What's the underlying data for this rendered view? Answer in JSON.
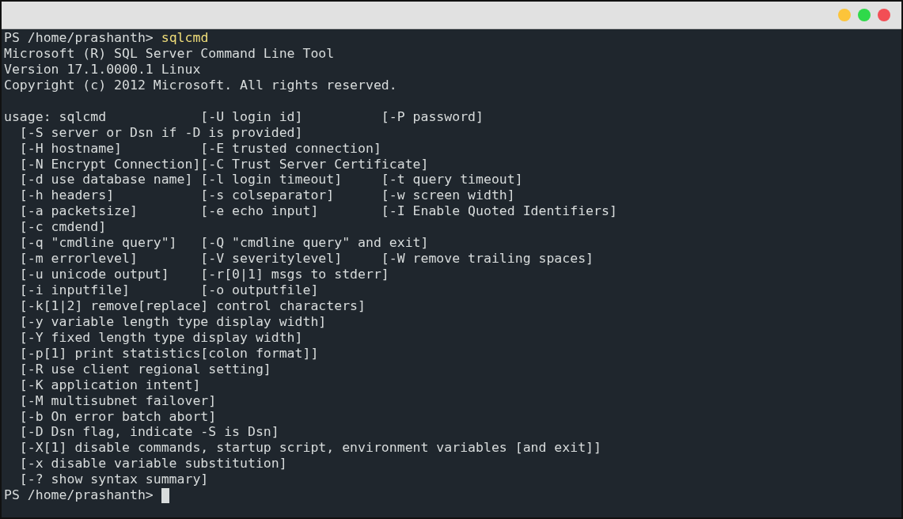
{
  "window": {
    "controls": [
      {
        "color": "#fcc43a"
      },
      {
        "color": "#2fd94a"
      },
      {
        "color": "#f24e55"
      }
    ]
  },
  "lines": [
    {
      "kind": "command",
      "prompt": "PS /home/prashanth>",
      "command": "sqlcmd"
    },
    {
      "kind": "output",
      "text": "Microsoft (R) SQL Server Command Line Tool"
    },
    {
      "kind": "output",
      "text": "Version 17.1.0000.1 Linux"
    },
    {
      "kind": "output",
      "text": "Copyright (c) 2012 Microsoft. All rights reserved."
    },
    {
      "kind": "blank"
    },
    {
      "kind": "output",
      "text": "usage: sqlcmd            [-U login id]          [-P password]"
    },
    {
      "kind": "output",
      "text": "  [-S server or Dsn if -D is provided]"
    },
    {
      "kind": "output",
      "text": "  [-H hostname]          [-E trusted connection]"
    },
    {
      "kind": "output",
      "text": "  [-N Encrypt Connection][-C Trust Server Certificate]"
    },
    {
      "kind": "output",
      "text": "  [-d use database name] [-l login timeout]     [-t query timeout]"
    },
    {
      "kind": "output",
      "text": "  [-h headers]           [-s colseparator]      [-w screen width]"
    },
    {
      "kind": "output",
      "text": "  [-a packetsize]        [-e echo input]        [-I Enable Quoted Identifiers]"
    },
    {
      "kind": "output",
      "text": "  [-c cmdend]"
    },
    {
      "kind": "output",
      "text": "  [-q \"cmdline query\"]   [-Q \"cmdline query\" and exit]"
    },
    {
      "kind": "output",
      "text": "  [-m errorlevel]        [-V severitylevel]     [-W remove trailing spaces]"
    },
    {
      "kind": "output",
      "text": "  [-u unicode output]    [-r[0|1] msgs to stderr]"
    },
    {
      "kind": "output",
      "text": "  [-i inputfile]         [-o outputfile]"
    },
    {
      "kind": "output",
      "text": "  [-k[1|2] remove[replace] control characters]"
    },
    {
      "kind": "output",
      "text": "  [-y variable length type display width]"
    },
    {
      "kind": "output",
      "text": "  [-Y fixed length type display width]"
    },
    {
      "kind": "output",
      "text": "  [-p[1] print statistics[colon format]]"
    },
    {
      "kind": "output",
      "text": "  [-R use client regional setting]"
    },
    {
      "kind": "output",
      "text": "  [-K application intent]"
    },
    {
      "kind": "output",
      "text": "  [-M multisubnet failover]"
    },
    {
      "kind": "output",
      "text": "  [-b On error batch abort]"
    },
    {
      "kind": "output",
      "text": "  [-D Dsn flag, indicate -S is Dsn]"
    },
    {
      "kind": "output",
      "text": "  [-X[1] disable commands, startup script, environment variables [and exit]]"
    },
    {
      "kind": "output",
      "text": "  [-x disable variable substitution]"
    },
    {
      "kind": "output",
      "text": "  [-? show syntax summary]"
    },
    {
      "kind": "prompt",
      "prompt": "PS /home/prashanth>",
      "cursor": true
    }
  ]
}
